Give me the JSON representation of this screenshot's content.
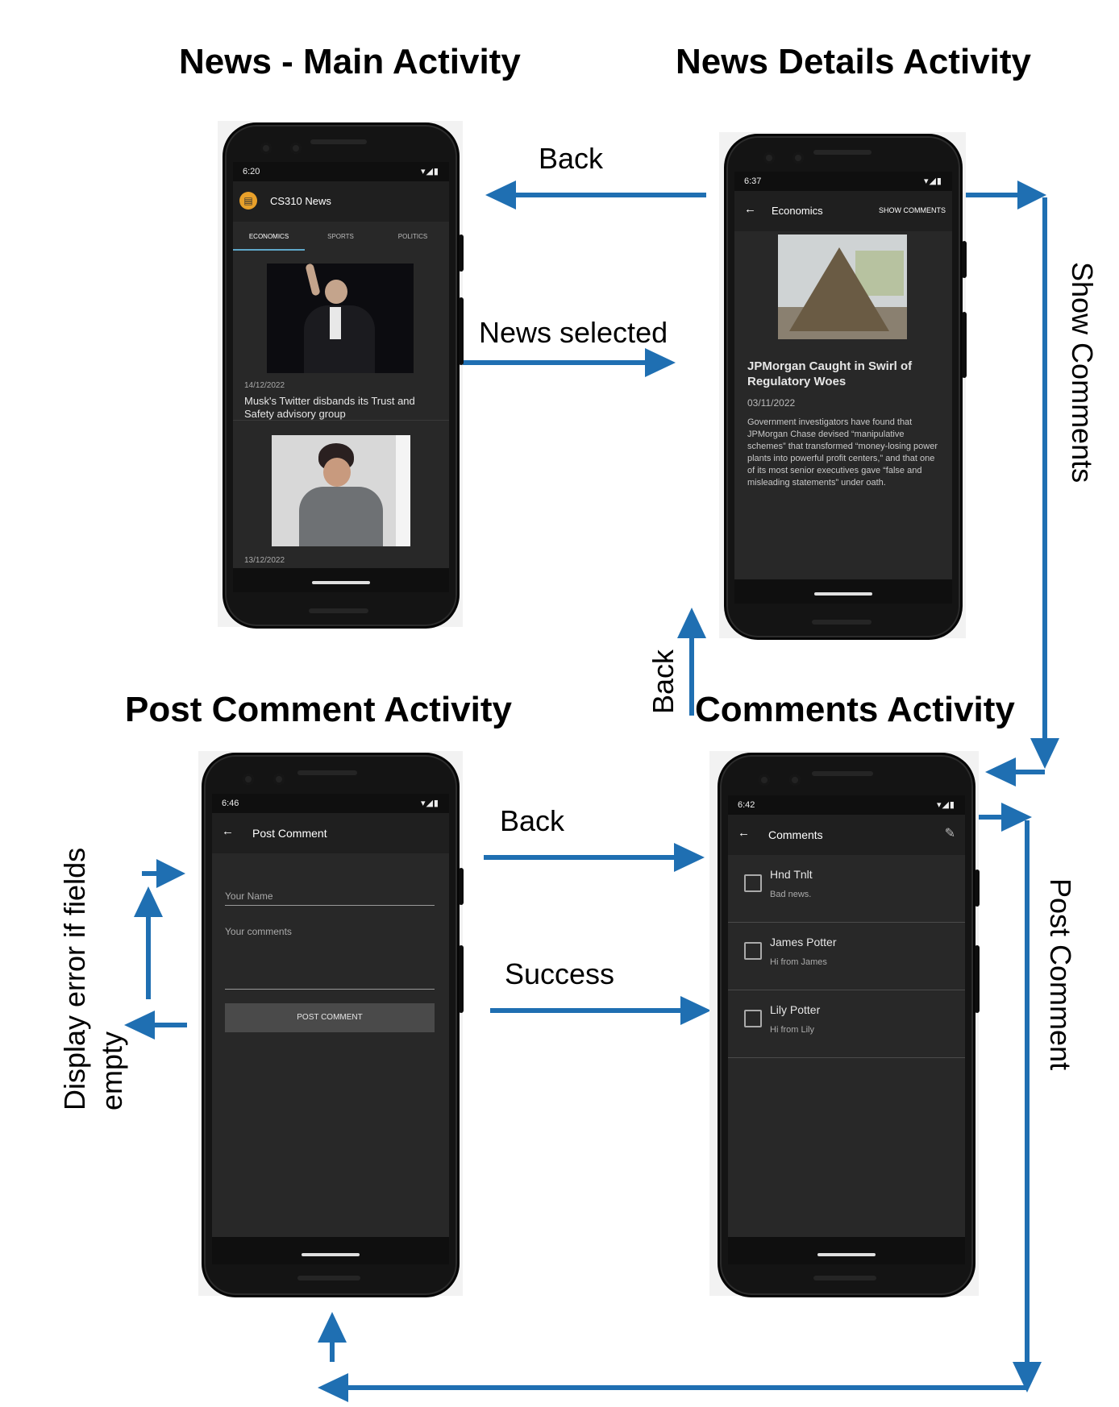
{
  "titles": {
    "main": "News - Main Activity",
    "details": "News Details Activity",
    "post": "Post Comment Activity",
    "comments": "Comments Activity"
  },
  "edges": {
    "back_top": "Back",
    "news_selected": "News selected",
    "show_comments": "Show Comments",
    "back_middle": "Back",
    "back_bottom": "Back",
    "success": "Success",
    "post_comment": "Post Comment",
    "display_error_line1": "Display error if fields",
    "display_error_line2": "empty"
  },
  "main_phone": {
    "time": "6:20",
    "app_title": "CS310 News",
    "tabs": [
      "ECONOMICS",
      "SPORTS",
      "POLITICS"
    ],
    "items": [
      {
        "date": "14/12/2022",
        "title": "Musk's Twitter disbands its Trust and Safety advisory group"
      },
      {
        "date": "13/12/2022",
        "title": ""
      }
    ]
  },
  "details_phone": {
    "time": "6:37",
    "title": "Economics",
    "action": "SHOW COMMENTS",
    "headline": "JPMorgan Caught in Swirl of Regulatory Woes",
    "date": "03/11/2022",
    "body": "Government investigators have found that JPMorgan Chase devised “manipulative schemes” that transformed “money-losing power plants into powerful profit centers,” and that one of its most senior executives gave “false and misleading statements” under oath."
  },
  "post_phone": {
    "time": "6:46",
    "title": "Post Comment",
    "name_placeholder": "Your Name",
    "comments_placeholder": "Your comments",
    "button": "POST COMMENT"
  },
  "comments_phone": {
    "time": "6:42",
    "title": "Comments",
    "items": [
      {
        "name": "Hnd Tnlt",
        "text": "Bad news."
      },
      {
        "name": "James Potter",
        "text": "Hi from James"
      },
      {
        "name": "Lily Potter",
        "text": "Hi from Lily"
      }
    ]
  },
  "colors": {
    "arrow": "#1f6fb2",
    "screen_bg": "#282828",
    "accent": "#5fa8c9"
  }
}
